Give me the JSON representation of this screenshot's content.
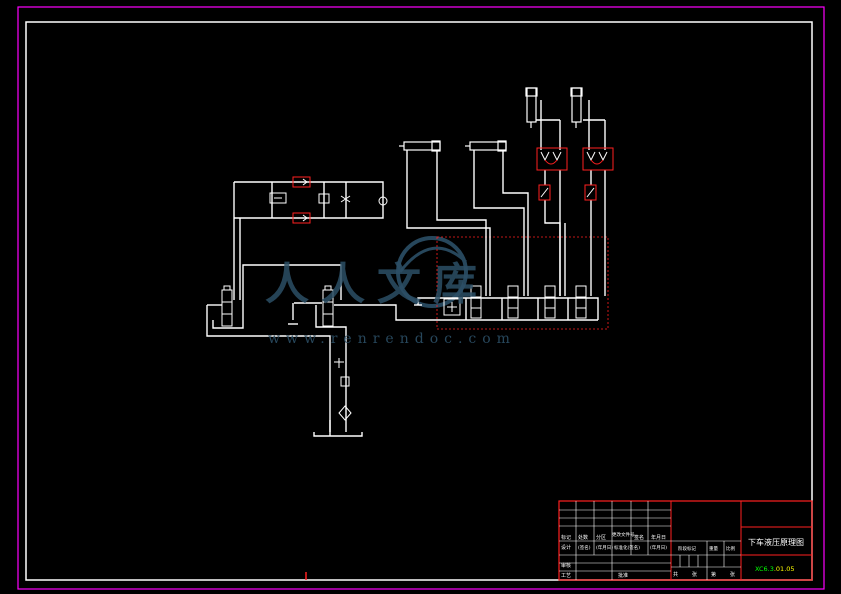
{
  "drawing": {
    "title": "下车液压原理图",
    "number_prefix": "XC6.3",
    "number_suffix": ".01.05"
  },
  "title_block": {
    "row1": [
      "标记",
      "处数",
      "分区",
      "更改文件号",
      "签名",
      "年月日"
    ],
    "row2": [
      "设计",
      "(签名)",
      "(年月日)",
      "标准化(签名)",
      "(年月日)"
    ],
    "row3": [
      "审核"
    ],
    "row4": [
      "工艺",
      "批准"
    ],
    "stage_label": "阶段标记",
    "weight_label": "重量",
    "scale_label": "比例",
    "sheet_total": "共",
    "sheet_word": "张",
    "sheet_no": "第"
  },
  "watermark": {
    "line1": "人人文库",
    "line2": "www.renrendoc.com"
  },
  "colors": {
    "background": "#000000",
    "line": "#ffffff",
    "frame": "#ff00ff",
    "title_border": "#ff0000",
    "group_box": "#ff0000",
    "number_green": "#00ff00",
    "watermark": "#2c4f66"
  }
}
